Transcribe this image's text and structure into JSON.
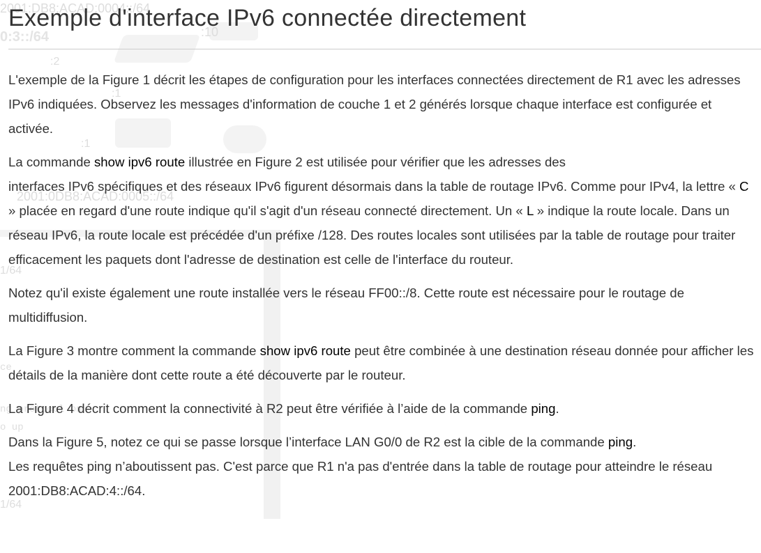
{
  "page": {
    "title": "Exemple d'interface IPv6 connectée directement"
  },
  "background_ghost": {
    "texts": [
      "2001:DB8:ACAD:0004::/64",
      ":10",
      "0:3::/64",
      ":2",
      ":1",
      ":1",
      "2001:0DB8:ACAD:0005::/64",
      "1/64",
      "ce",
      "ng protocol on",
      "o up",
      "1/64"
    ]
  },
  "paragraphs": {
    "p1": "L'exemple de la Figure 1 décrit les étapes de configuration pour les interfaces connectées directement de R1 avec les adresses IPv6 indiquées. Observez les messages d'information de couche 1 et 2 générés lorsque chaque interface est configurée et activée.",
    "p2": {
      "a": "La commande ",
      "cmd": "show ipv6 route",
      "b": " illustrée en Figure 2 est utilisée pour vérifier que les adresses des",
      "c": "interfaces IPv6 spécifiques et des réseaux IPv6 figurent désormais dans la table de routage IPv6. Comme pour IPv4, la lettre « ",
      "letter_c": "C",
      "d": " » placée en regard d'une route indique qu'il s'agit d'un réseau connecté directement. Un « ",
      "letter_l": "L",
      "e": " » indique la route locale. Dans un réseau IPv6, la route locale est précédée d'un préfixe /128. Des routes locales sont utilisées par la table de routage pour traiter efficacement les paquets dont l'adresse de destination est celle de l'interface du routeur."
    },
    "p3": "Notez qu'il existe également une route installée vers le réseau FF00::/8. Cette route est nécessaire pour le routage de multidiffusion.",
    "p4": {
      "a": "La Figure 3 montre comment la commande ",
      "cmd": "show ipv6 route",
      "b": " peut être combinée à une destination réseau donnée pour afficher les détails de la manière dont cette route a été découverte par le routeur."
    },
    "p5": {
      "a": "La Figure 4 décrit comment la connectivité à R2 peut être vérifiée à l’aide de la commande ",
      "cmd": "ping",
      "b": "."
    },
    "p6": {
      "a": "Dans la Figure 5, notez ce qui se passe lorsque l’interface LAN G0/0 de R2 est la cible de la commande ",
      "cmd": "ping",
      "b": ".",
      "c": "Les requêtes ping n’aboutissent pas. C'est parce que R1 n'a pas d'entrée dans la table de routage pour atteindre le réseau 2001:DB8:ACAD:4::/64."
    }
  }
}
